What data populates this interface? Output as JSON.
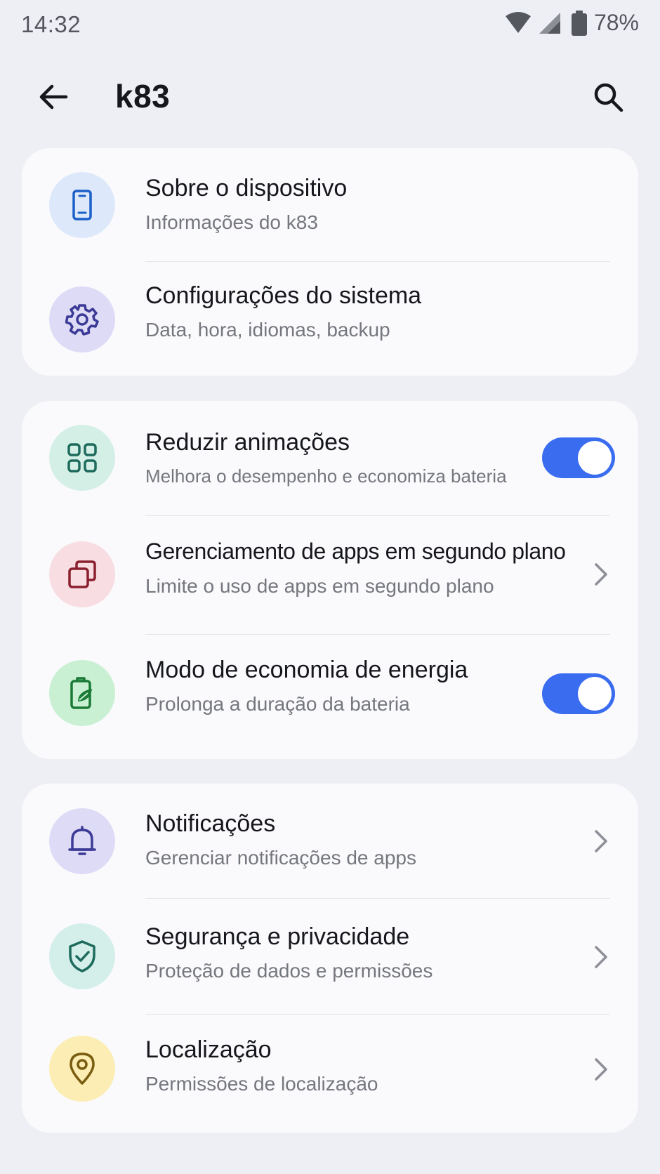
{
  "status_bar": {
    "time": "14:32",
    "battery": "78%",
    "icons": [
      "wifi-icon",
      "signal-icon",
      "battery-icon"
    ]
  },
  "header": {
    "title": "k83",
    "back_icon": "arrow-back-icon",
    "search_icon": "search-icon"
  },
  "sections": [
    {
      "items": [
        {
          "title": "Sobre o dispositivo",
          "subtitle": "Informações do k83",
          "icon": "phone-icon",
          "icon_bg": "#dde9fb",
          "icon_color": "#1d5fc8"
        },
        {
          "title": "Configurações do sistema",
          "subtitle": "Data, hora, idiomas, backup",
          "icon": "gear-icon",
          "icon_bg": "#dedbf7",
          "icon_color": "#3b3a96"
        }
      ]
    },
    {
      "items": [
        {
          "title": "Reduzir animações",
          "subtitle": "Melhora o desempenho e economiza bateria",
          "icon": "grid-icon",
          "icon_bg": "#d4efe6",
          "icon_color": "#1e6b5d",
          "control": "toggle",
          "enabled": true
        },
        {
          "title": "Gerenciamento de apps em segundo plano",
          "subtitle": "Limite o uso de apps em segundo plano",
          "icon": "layers-icon",
          "icon_bg": "#f8dde2",
          "icon_color": "#8a1f2e",
          "control": "chevron"
        },
        {
          "title": "Modo de economia de energia",
          "subtitle": "Prolonga a duração da bateria",
          "icon": "battery-leaf-icon",
          "icon_bg": "#c9f0d2",
          "icon_color": "#1a7a36",
          "control": "toggle",
          "enabled": true
        }
      ]
    },
    {
      "items": [
        {
          "title": "Notificações",
          "subtitle": "Gerenciar notificações de apps",
          "icon": "bell-icon",
          "icon_bg": "#dedbf7",
          "icon_color": "#3b3a96",
          "control": "chevron"
        },
        {
          "title": "Segurança e privacidade",
          "subtitle": "Proteção de dados e permissões",
          "icon": "shield-check-icon",
          "icon_bg": "#d4efe9",
          "icon_color": "#1e6b5d",
          "control": "chevron"
        },
        {
          "title": "Localização",
          "subtitle": "Permissões de localização",
          "icon": "location-pin-icon",
          "icon_bg": "#fbedb3",
          "icon_color": "#7a5c10",
          "control": "chevron"
        }
      ]
    }
  ],
  "colors": {
    "background": "#eeeff4",
    "card": "#fafafc",
    "toggle_on": "#3a6cf0",
    "subtitle": "#75777e"
  }
}
